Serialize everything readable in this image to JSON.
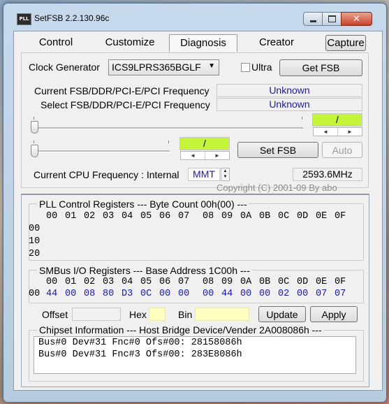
{
  "window": {
    "title": "SetFSB 2.2.130.96c",
    "icon": "pll-icon"
  },
  "tabs": [
    "Control",
    "Customize",
    "Diagnosis",
    "Creator"
  ],
  "capture_label": "Capture",
  "clock": {
    "label": "Clock Generator",
    "value": "ICS9LPRS365BGLF",
    "ultra_label": "Ultra",
    "get_fsb_label": "Get FSB"
  },
  "freq": {
    "current_label": "Current FSB/DDR/PCI-E/PCI Frequency",
    "current_value": "Unknown",
    "select_label": "Select FSB/DDR/PCI-E/PCI Frequency",
    "select_value": "Unknown"
  },
  "sliders": {
    "top_display": "/",
    "bottom_display": "/"
  },
  "set_fsb_label": "Set FSB",
  "auto_label": "Auto",
  "cpu": {
    "label": "Current CPU Frequency : Internal",
    "source": "MMT",
    "value": "2593.6MHz"
  },
  "copyright": "Copyright (C) 2001-09 By abo",
  "pll": {
    "title": "PLL Control Registers  --- Byte Count 00h(00) ---",
    "columns": [
      "00",
      "01",
      "02",
      "03",
      "04",
      "05",
      "06",
      "07",
      "08",
      "09",
      "0A",
      "0B",
      "0C",
      "0D",
      "0E",
      "0F"
    ],
    "rows": [
      "00",
      "10",
      "20"
    ]
  },
  "smbus": {
    "title": "SMBus I/O Registers  --- Base Address 1C00h ---",
    "columns": [
      "00",
      "01",
      "02",
      "03",
      "04",
      "05",
      "06",
      "07",
      "08",
      "09",
      "0A",
      "0B",
      "0C",
      "0D",
      "0E",
      "0F"
    ],
    "row_label": "00",
    "values": [
      "44",
      "00",
      "08",
      "80",
      "D3",
      "0C",
      "00",
      "00",
      "00",
      "44",
      "00",
      "00",
      "02",
      "00",
      "07",
      "07"
    ]
  },
  "edit": {
    "offset_label": "Offset",
    "hex_label": "Hex",
    "bin_label": "Bin",
    "update_label": "Update",
    "apply_label": "Apply"
  },
  "chipset": {
    "title": "Chipset Information  --- Host Bridge Device/Vender 2A008086h ---",
    "lines": [
      "Bus#0 Dev#31 Fnc#0 Ofs#00: 28158086h",
      "Bus#0 Dev#31 Fnc#3 Ofs#00: 283E8086h"
    ]
  },
  "colors": {
    "value_blue": "#1a1aa6",
    "lime": "#c4f53b",
    "input_yellow": "#ffffc0"
  }
}
